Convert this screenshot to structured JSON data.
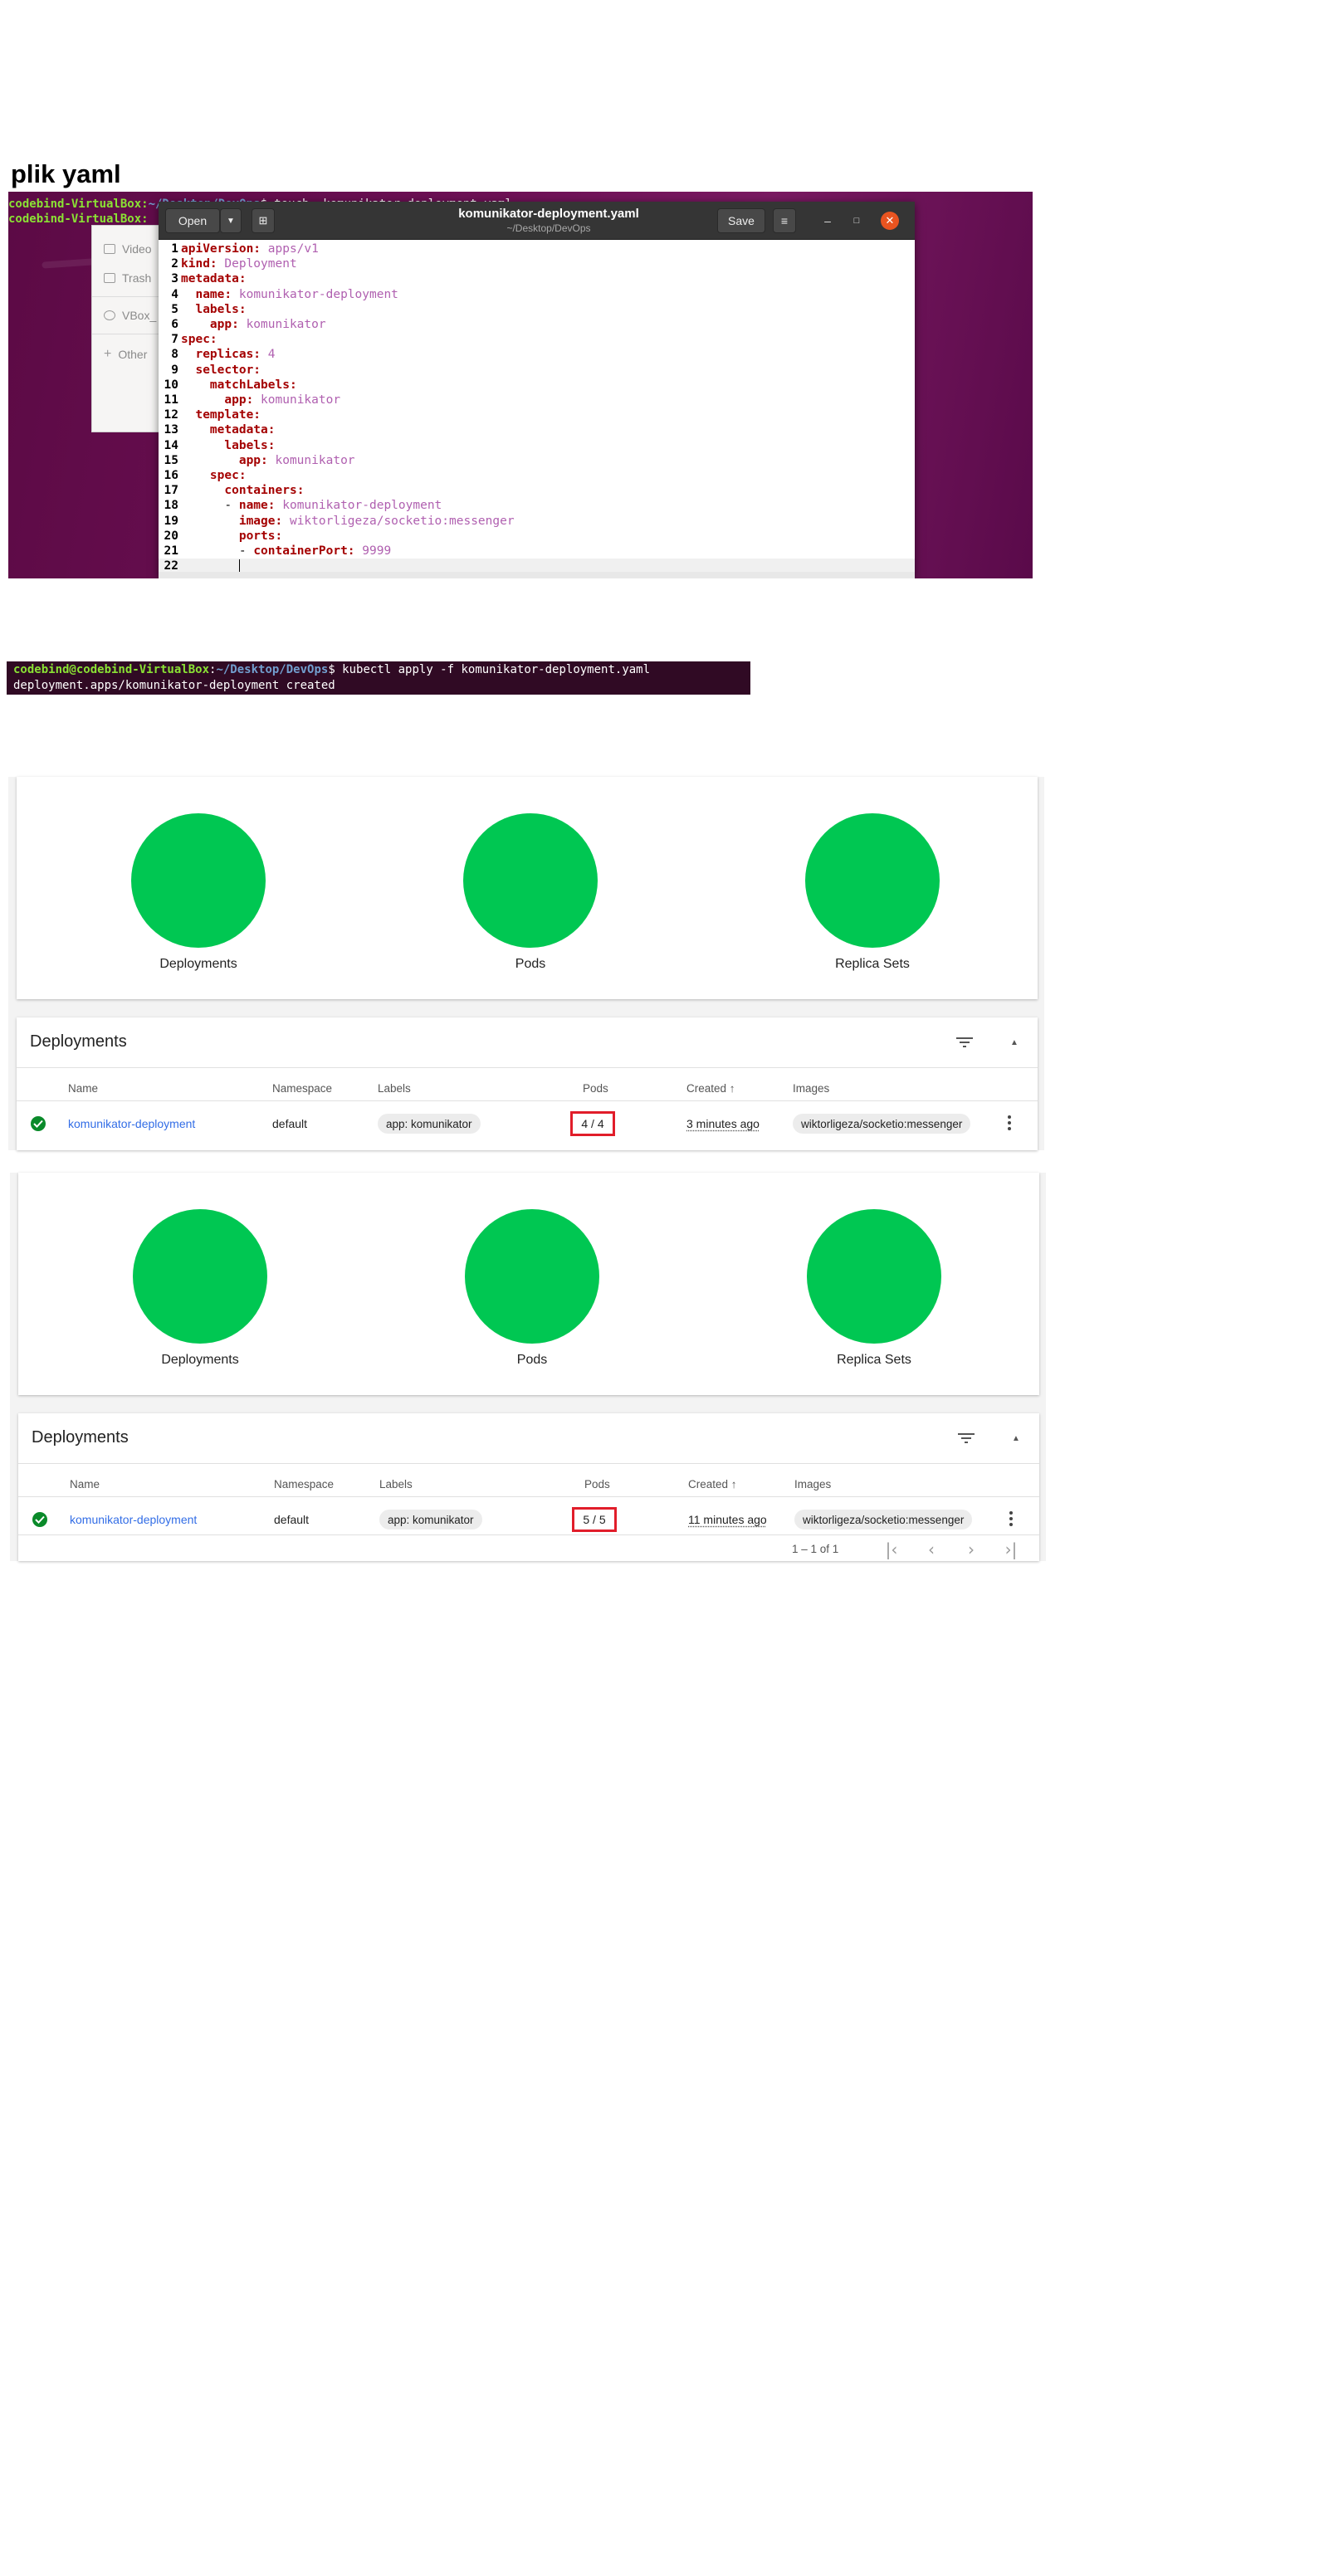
{
  "heading": "plik yaml",
  "desktop": {
    "terminal_lines": [
      {
        "user": "codebind-VirtualBox:",
        "path": "~/Desktop/DevOps",
        "cmd": "$ touch  komunikator-deployment.yaml"
      },
      {
        "user": "codebind-VirtualBox:",
        "path": "",
        "cmd": ""
      }
    ],
    "files_sidebar": [
      "Video",
      "Trash",
      "VBox_",
      "Other"
    ],
    "gedit": {
      "open_label": "Open",
      "save_label": "Save",
      "title": "komunikator-deployment.yaml",
      "subtitle": "~/Desktop/DevOps",
      "lines": [
        {
          "n": "1",
          "indent": "",
          "key": "apiVersion:",
          "val": " apps/v1"
        },
        {
          "n": "2",
          "indent": "",
          "key": "kind:",
          "val": " Deployment"
        },
        {
          "n": "3",
          "indent": "",
          "key": "metadata:",
          "val": ""
        },
        {
          "n": "4",
          "indent": "  ",
          "key": "name:",
          "val": " komunikator-deployment"
        },
        {
          "n": "5",
          "indent": "  ",
          "key": "labels:",
          "val": ""
        },
        {
          "n": "6",
          "indent": "    ",
          "key": "app:",
          "val": " komunikator"
        },
        {
          "n": "7",
          "indent": "",
          "key": "spec:",
          "val": ""
        },
        {
          "n": "8",
          "indent": "  ",
          "key": "replicas:",
          "val": " 4"
        },
        {
          "n": "9",
          "indent": "  ",
          "key": "selector:",
          "val": ""
        },
        {
          "n": "10",
          "indent": "    ",
          "key": "matchLabels:",
          "val": ""
        },
        {
          "n": "11",
          "indent": "      ",
          "key": "app:",
          "val": " komunikator"
        },
        {
          "n": "12",
          "indent": "  ",
          "key": "template:",
          "val": ""
        },
        {
          "n": "13",
          "indent": "    ",
          "key": "metadata:",
          "val": ""
        },
        {
          "n": "14",
          "indent": "      ",
          "key": "labels:",
          "val": ""
        },
        {
          "n": "15",
          "indent": "        ",
          "key": "app:",
          "val": " komunikator"
        },
        {
          "n": "16",
          "indent": "    ",
          "key": "spec:",
          "val": ""
        },
        {
          "n": "17",
          "indent": "      ",
          "key": "containers:",
          "val": ""
        },
        {
          "n": "18",
          "indent": "      - ",
          "key": "name:",
          "val": " komunikator-deployment"
        },
        {
          "n": "19",
          "indent": "        ",
          "key": "image:",
          "val": " wiktorligeza/socketio:messenger"
        },
        {
          "n": "20",
          "indent": "        ",
          "key": "ports:",
          "val": ""
        },
        {
          "n": "21",
          "indent": "        - ",
          "key": "containerPort:",
          "val": " 9999"
        },
        {
          "n": "22",
          "indent": "        ",
          "key": "",
          "val": ""
        }
      ]
    }
  },
  "terminal2": {
    "user": "codebind@codebind-VirtualBox",
    "path": "~/Desktop/DevOps",
    "cmd": "$ kubectl apply -f komunikator-deployment.yaml",
    "output": "deployment.apps/komunikator-deployment created"
  },
  "dashboards": [
    {
      "workloads": [
        "Deployments",
        "Pods",
        "Replica Sets"
      ],
      "card_title": "Deployments",
      "columns": [
        "Name",
        "Namespace",
        "Labels",
        "Pods",
        "Created",
        "Images"
      ],
      "row": {
        "name": "komunikator-deployment",
        "namespace": "default",
        "label": "app: komunikator",
        "pods": "4 / 4",
        "created": "3 minutes ago",
        "image": "wiktorligeza/socketio:messenger"
      },
      "sort_arrow": "↑"
    },
    {
      "workloads": [
        "Deployments",
        "Pods",
        "Replica Sets"
      ],
      "card_title": "Deployments",
      "columns": [
        "Name",
        "Namespace",
        "Labels",
        "Pods",
        "Created",
        "Images"
      ],
      "row": {
        "name": "komunikator-deployment",
        "namespace": "default",
        "label": "app: komunikator",
        "pods": "5 / 5",
        "created": "11 minutes ago",
        "image": "wiktorligeza/socketio:messenger"
      },
      "sort_arrow": "↑",
      "pager": "1 – 1 of 1"
    }
  ],
  "colors": {
    "status_green": "#00c752",
    "highlight_red": "#e11d2a",
    "link_blue": "#326de6",
    "terminal_bg": "#300a24"
  }
}
